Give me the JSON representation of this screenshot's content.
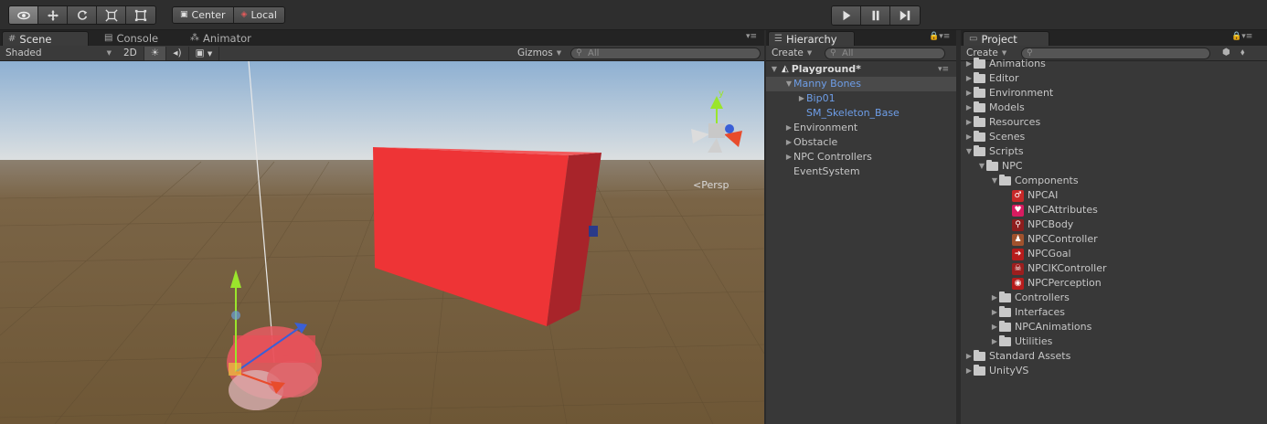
{
  "toolbar": {
    "pivot_center": "Center",
    "pivot_local": "Local"
  },
  "scene": {
    "tabs": [
      "Scene",
      "Console",
      "Animator"
    ],
    "shading": "Shaded",
    "mode_2d": "2D",
    "gizmos": "Gizmos",
    "search_placeholder": "All",
    "persp_label": "Persp",
    "gizmo_axis_y": "y",
    "colors": {
      "sky_top": "#95b5d4",
      "horizon": "#d6dde3",
      "ground": "#6f5a3c",
      "cube": "#ee3436",
      "cube_side": "#a8242a"
    }
  },
  "hierarchy": {
    "tab": "Hierarchy",
    "create": "Create",
    "search_placeholder": "All",
    "scene_name": "Playground*",
    "items": [
      {
        "label": "Manny Bones",
        "blue": true,
        "selected": true,
        "indent": 1,
        "arrow": "open"
      },
      {
        "label": "Bip01",
        "blue": true,
        "indent": 2,
        "arrow": "closed"
      },
      {
        "label": "SM_Skeleton_Base",
        "blue": true,
        "indent": 2,
        "arrow": "none"
      },
      {
        "label": "Environment",
        "blue": false,
        "indent": 1,
        "arrow": "closed"
      },
      {
        "label": "Obstacle",
        "blue": false,
        "indent": 1,
        "arrow": "closed"
      },
      {
        "label": "NPC Controllers",
        "blue": false,
        "indent": 1,
        "arrow": "closed"
      },
      {
        "label": "EventSystem",
        "blue": false,
        "indent": 1,
        "arrow": "none"
      }
    ]
  },
  "project": {
    "tab": "Project",
    "create": "Create",
    "items": [
      {
        "label": "Animations",
        "indent": 0,
        "arrow": "closed",
        "kind": "folder"
      },
      {
        "label": "Editor",
        "indent": 0,
        "arrow": "closed",
        "kind": "folder"
      },
      {
        "label": "Environment",
        "indent": 0,
        "arrow": "closed",
        "kind": "folder"
      },
      {
        "label": "Models",
        "indent": 0,
        "arrow": "closed",
        "kind": "folder"
      },
      {
        "label": "Resources",
        "indent": 0,
        "arrow": "closed",
        "kind": "folder"
      },
      {
        "label": "Scenes",
        "indent": 0,
        "arrow": "closed",
        "kind": "folder"
      },
      {
        "label": "Scripts",
        "indent": 0,
        "arrow": "open",
        "kind": "folder"
      },
      {
        "label": "NPC",
        "indent": 1,
        "arrow": "open",
        "kind": "folder"
      },
      {
        "label": "Components",
        "indent": 2,
        "arrow": "open",
        "kind": "folder"
      },
      {
        "label": "NPCAI",
        "indent": 3,
        "arrow": "none",
        "kind": "script",
        "icon": "gender-icon",
        "color": "#c62828",
        "glyph": "♂"
      },
      {
        "label": "NPCAttributes",
        "indent": 3,
        "arrow": "none",
        "kind": "script",
        "icon": "heart-icon",
        "color": "#d81b60",
        "glyph": "♥"
      },
      {
        "label": "NPCBody",
        "indent": 3,
        "arrow": "none",
        "kind": "script",
        "icon": "walking-icon",
        "color": "#8e1d1d",
        "glyph": "⚲"
      },
      {
        "label": "NPCController",
        "indent": 3,
        "arrow": "none",
        "kind": "script",
        "icon": "person-icon",
        "color": "#a0522d",
        "glyph": "♟"
      },
      {
        "label": "NPCGoal",
        "indent": 3,
        "arrow": "none",
        "kind": "script",
        "icon": "arrow-right-icon",
        "color": "#b71c1c",
        "glyph": "➜"
      },
      {
        "label": "NPCIKController",
        "indent": 3,
        "arrow": "none",
        "kind": "script",
        "icon": "skull-icon",
        "color": "#9c1e1e",
        "glyph": "☠"
      },
      {
        "label": "NPCPerception",
        "indent": 3,
        "arrow": "none",
        "kind": "script",
        "icon": "eye-icon",
        "color": "#b71c1c",
        "glyph": "◉"
      },
      {
        "label": "Controllers",
        "indent": 2,
        "arrow": "closed",
        "kind": "folder"
      },
      {
        "label": "Interfaces",
        "indent": 2,
        "arrow": "closed",
        "kind": "folder"
      },
      {
        "label": "NPCAnimations",
        "indent": 2,
        "arrow": "closed",
        "kind": "folder"
      },
      {
        "label": "Utilities",
        "indent": 2,
        "arrow": "closed",
        "kind": "folder"
      },
      {
        "label": "Standard Assets",
        "indent": 0,
        "arrow": "closed",
        "kind": "folder"
      },
      {
        "label": "UnityVS",
        "indent": 0,
        "arrow": "closed",
        "kind": "folder"
      }
    ]
  }
}
